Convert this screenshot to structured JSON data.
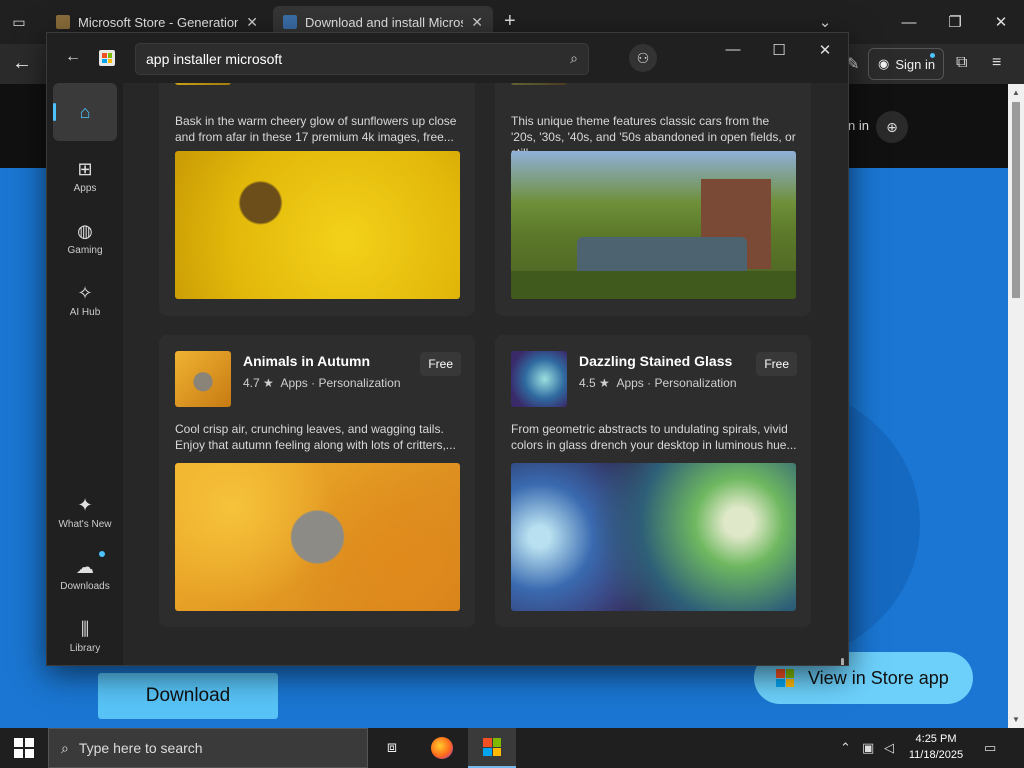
{
  "browser": {
    "tabs": [
      {
        "title": "Microsoft Store - Generation Pr",
        "close": "✕"
      },
      {
        "title": "Download and install Microsoft",
        "close": "✕"
      }
    ],
    "new_tab": "+",
    "nav_signin": "Sign in"
  },
  "page": {
    "signin_partial": "n in",
    "download_label": "Download",
    "view_in_store_label": "View in Store app"
  },
  "store": {
    "search_value": "app installer microsoft",
    "sidebar": [
      {
        "label": "",
        "icon": "home-icon"
      },
      {
        "label": "Apps",
        "icon": "apps-icon"
      },
      {
        "label": "Gaming",
        "icon": "gaming-icon"
      },
      {
        "label": "AI Hub",
        "icon": "ai-hub-icon"
      },
      {
        "label": "What's New",
        "icon": "whats-new-icon"
      },
      {
        "label": "Downloads",
        "icon": "downloads-icon"
      },
      {
        "label": "Library",
        "icon": "library-icon"
      }
    ],
    "cards": [
      {
        "desc": "Bask in the warm cheery glow of sunflowers up close and from afar in these 17 premium 4k images, free..."
      },
      {
        "desc": "This unique theme features classic cars from the '20s, '30s, '40s, and '50s abandoned in open fields, or still..."
      },
      {
        "name": "Animals in Autumn",
        "rating": "4.7 ★",
        "category": "Apps",
        "subcategory": "Personalization",
        "price": "Free",
        "desc": "Cool crisp air, crunching leaves, and wagging tails. Enjoy that autumn feeling along with lots of critters,..."
      },
      {
        "name": "Dazzling Stained Glass",
        "rating": "4.5 ★",
        "category": "Apps",
        "subcategory": "Personalization",
        "price": "Free",
        "desc": "From geometric abstracts to undulating spirals, vivid colors in glass drench your desktop in luminous hue..."
      }
    ]
  },
  "taskbar": {
    "search_placeholder": "Type here to search",
    "time": "4:25 PM",
    "date": "11/18/2025"
  },
  "colors": {
    "accent": "#4cc2ff",
    "page_blue": "#1a76d2",
    "download_button": "#57c3f6"
  }
}
